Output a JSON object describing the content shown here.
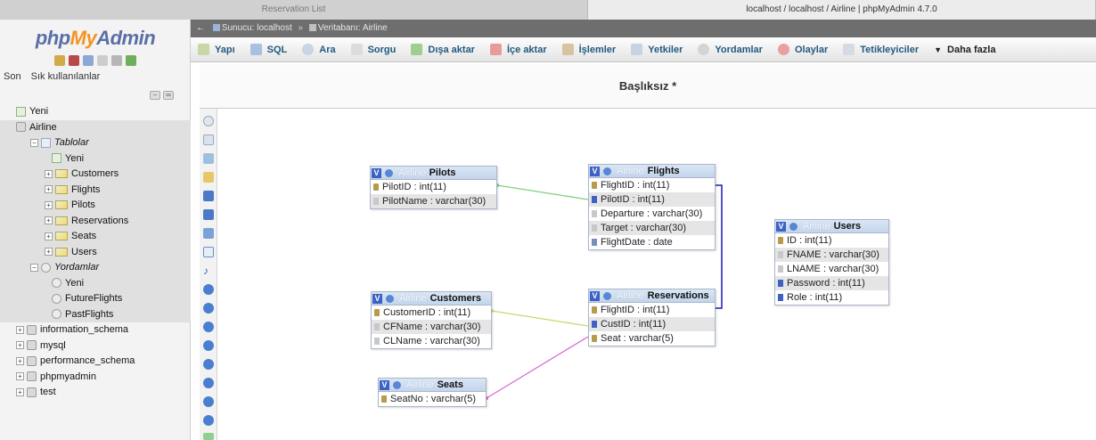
{
  "browser_tabs": [
    {
      "title": "Reservation List",
      "active": false
    },
    {
      "title": "localhost / localhost / Airline | phpMyAdmin 4.7.0",
      "active": true
    }
  ],
  "logo": {
    "php": "php",
    "my": "My",
    "admin": "Admin"
  },
  "quick_icons": [
    "home-icon",
    "logout-icon",
    "docs-icon",
    "sql-docs-icon",
    "settings-icon",
    "reload-icon"
  ],
  "recent": {
    "recent_label": "Son",
    "favorites_label": "Sık kullanılanlar"
  },
  "nav_tree": [
    {
      "label": "Yeni"
    },
    {
      "label": "Airline"
    },
    {
      "label": "Tablolar"
    },
    {
      "label": "Yeni"
    },
    {
      "label": "Customers"
    },
    {
      "label": "Flights"
    },
    {
      "label": "Pilots"
    },
    {
      "label": "Reservations"
    },
    {
      "label": "Seats"
    },
    {
      "label": "Users"
    },
    {
      "label": "Yordamlar"
    },
    {
      "label": "Yeni"
    },
    {
      "label": "FutureFlights"
    },
    {
      "label": "PastFlights"
    },
    {
      "label": "information_schema"
    },
    {
      "label": "mysql"
    },
    {
      "label": "performance_schema"
    },
    {
      "label": "phpmyadmin"
    },
    {
      "label": "test"
    }
  ],
  "breadcrumb": {
    "server": "Sunucu: localhost",
    "database": "Veritabanı: Airline"
  },
  "menu": [
    {
      "label": "Yapı",
      "icon": "structure-icon"
    },
    {
      "label": "SQL",
      "icon": "sql-icon"
    },
    {
      "label": "Ara",
      "icon": "search-icon"
    },
    {
      "label": "Sorgu",
      "icon": "query-icon"
    },
    {
      "label": "Dışa aktar",
      "icon": "export-icon"
    },
    {
      "label": "İçe aktar",
      "icon": "import-icon"
    },
    {
      "label": "İşlemler",
      "icon": "operations-icon"
    },
    {
      "label": "Yetkiler",
      "icon": "privileges-icon"
    },
    {
      "label": "Yordamlar",
      "icon": "routines-icon"
    },
    {
      "label": "Olaylar",
      "icon": "events-icon"
    },
    {
      "label": "Tetikleyiciler",
      "icon": "triggers-icon"
    },
    {
      "label": "Daha fazla",
      "icon": "more-icon"
    }
  ],
  "designer": {
    "title": "Başlıksız *",
    "tables": {
      "pilots": {
        "db": "Airline",
        "name": "Pilots",
        "columns": [
          "PilotID : int(11)",
          "PilotName : varchar(30)"
        ]
      },
      "flights": {
        "db": "Airline",
        "name": "Flights",
        "columns": [
          "FlightID : int(11)",
          "PilotID : int(11)",
          "Departure : varchar(30)",
          "Target : varchar(30)",
          "FlightDate : date"
        ]
      },
      "users": {
        "db": "Airline",
        "name": "Users",
        "columns": [
          "ID : int(11)",
          "FNAME : varchar(30)",
          "LNAME : varchar(30)",
          "Password : int(11)",
          "Role : int(11)"
        ]
      },
      "customers": {
        "db": "Airline",
        "name": "Customers",
        "columns": [
          "CustomerID : int(11)",
          "CFName : varchar(30)",
          "CLName : varchar(30)"
        ]
      },
      "reservations": {
        "db": "Airline",
        "name": "Reservations",
        "columns": [
          "FlightID : int(11)",
          "CustID : int(11)",
          "Seat : varchar(5)"
        ]
      },
      "seats": {
        "db": "Airline",
        "name": "Seats",
        "columns": [
          "SeatNo : varchar(5)"
        ]
      }
    }
  },
  "colors": {
    "link_pilot": "#7fd07f",
    "link_flight": "#1a1ab8",
    "link_customer": "#c8d86a",
    "link_seat": "#d86ad8"
  }
}
